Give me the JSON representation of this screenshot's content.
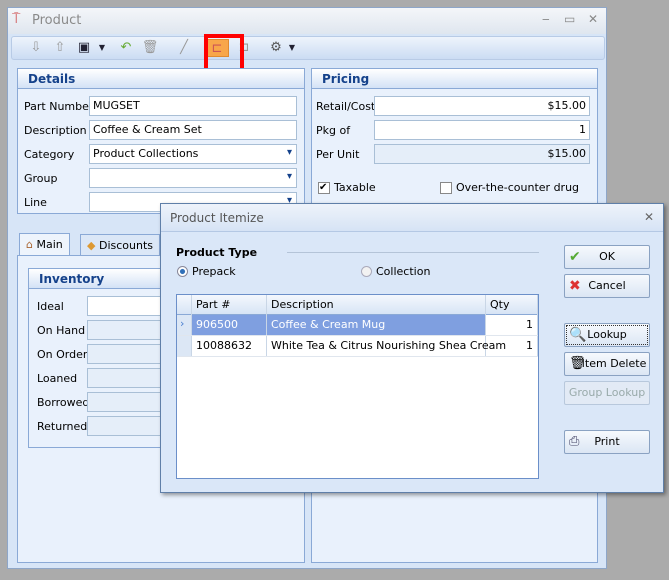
{
  "window": {
    "title": "Product",
    "minimize": "▭",
    "maximize": "▭",
    "close": "✕"
  },
  "toolbar": {
    "icons": [
      "arrow-down-icon",
      "arrow-up-icon",
      "save-icon",
      "undo-icon",
      "trash-icon",
      "pencil-icon",
      "itemize-icon",
      "group-icon",
      "gear-icon"
    ],
    "highlighted": "itemize-icon"
  },
  "details": {
    "title": "Details",
    "part_number_label": "Part Number",
    "part_number": "MUGSET",
    "description_label": "Description",
    "description": "Coffee & Cream Set",
    "category_label": "Category",
    "category": "Product Collections",
    "group_label": "Group",
    "group": "",
    "line_label": "Line",
    "line": ""
  },
  "pricing": {
    "title": "Pricing",
    "retail_label": "Retail/Cost",
    "retail": "$15.00",
    "pkg_label": "Pkg of",
    "pkg": "1",
    "per_unit_label": "Per Unit",
    "per_unit": "$15.00",
    "taxable_label": "Taxable",
    "taxable": true,
    "otc_label": "Over-the-counter drug",
    "otc": false
  },
  "tabs": [
    {
      "label": "Main",
      "active": true
    },
    {
      "label": "Discounts",
      "active": false
    }
  ],
  "inventory": {
    "title": "Inventory",
    "fields": [
      "Ideal",
      "On Hand",
      "On Order",
      "Loaned",
      "Borrowed",
      "Returned"
    ]
  },
  "dialog": {
    "title": "Product Itemize",
    "close": "✕",
    "product_type_label": "Product Type",
    "prepack_label": "Prepack",
    "collection_label": "Collection",
    "selected_type": "Prepack",
    "columns": [
      "Part #",
      "Description",
      "Qty"
    ],
    "rows": [
      {
        "part": "906500",
        "description": "Coffee & Cream Mug",
        "qty": "1",
        "selected": true
      },
      {
        "part": "10088632",
        "description": "White Tea & Citrus Nourishing Shea Cream",
        "qty": "1",
        "selected": false
      }
    ],
    "buttons": {
      "ok": "OK",
      "cancel": "Cancel",
      "lookup": "Lookup",
      "item_delete": "Item Delete",
      "group_lookup": "Group Lookup",
      "print": "Print"
    }
  },
  "colors": {
    "selected_row": "#7f9fe0",
    "highlight_box": "#ff0000",
    "accent": "#15428b"
  }
}
